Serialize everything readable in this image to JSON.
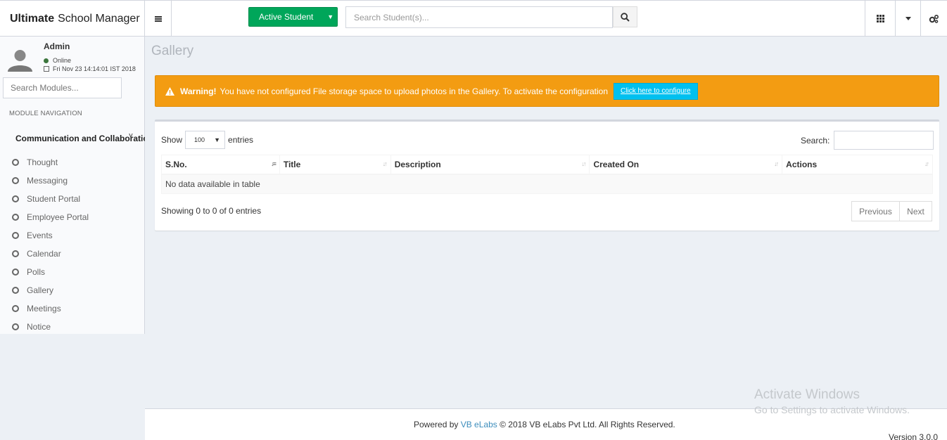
{
  "header": {
    "logo_bold": "Ultimate",
    "logo_rest": "School Manager",
    "active_button": "Active Student",
    "search_placeholder": "Search Student(s)..."
  },
  "sidebar": {
    "user_name": "Admin",
    "status": "Online",
    "datetime": "Fri Nov 23 14:14:01 IST 2018",
    "search_placeholder": "Search Modules...",
    "nav_heading": "MODULE NAVIGATION",
    "parent": "Communication and Collaboration",
    "items": [
      {
        "label": "Thought"
      },
      {
        "label": "Messaging"
      },
      {
        "label": "Student Portal"
      },
      {
        "label": "Employee Portal"
      },
      {
        "label": "Events"
      },
      {
        "label": "Calendar"
      },
      {
        "label": "Polls"
      },
      {
        "label": "Gallery"
      },
      {
        "label": "Meetings"
      },
      {
        "label": "Notice"
      }
    ]
  },
  "page": {
    "title": "Gallery"
  },
  "alert": {
    "strong": "Warning!",
    "message": "You have not configured File storage space to upload photos in the Gallery. To activate the configuration",
    "button": "Click here to configure",
    "color": "#f39c12"
  },
  "table": {
    "show_label": "Show",
    "entries_value": "100",
    "entries_label": "entries",
    "search_label": "Search:",
    "columns": [
      "S.No.",
      "Title",
      "Description",
      "Created On",
      "Actions"
    ],
    "empty": "No data available in table",
    "info": "Showing 0 to 0 of 0 entries",
    "prev": "Previous",
    "next": "Next"
  },
  "footer": {
    "powered": "Powered by",
    "company_link": "VB eLabs",
    "copyright": "© 2018 VB eLabs Pvt Ltd. All Rights Reserved.",
    "version": "Version 3.0.0"
  },
  "watermark": {
    "line1": "Activate Windows",
    "line2": "Go to Settings to activate Windows."
  }
}
